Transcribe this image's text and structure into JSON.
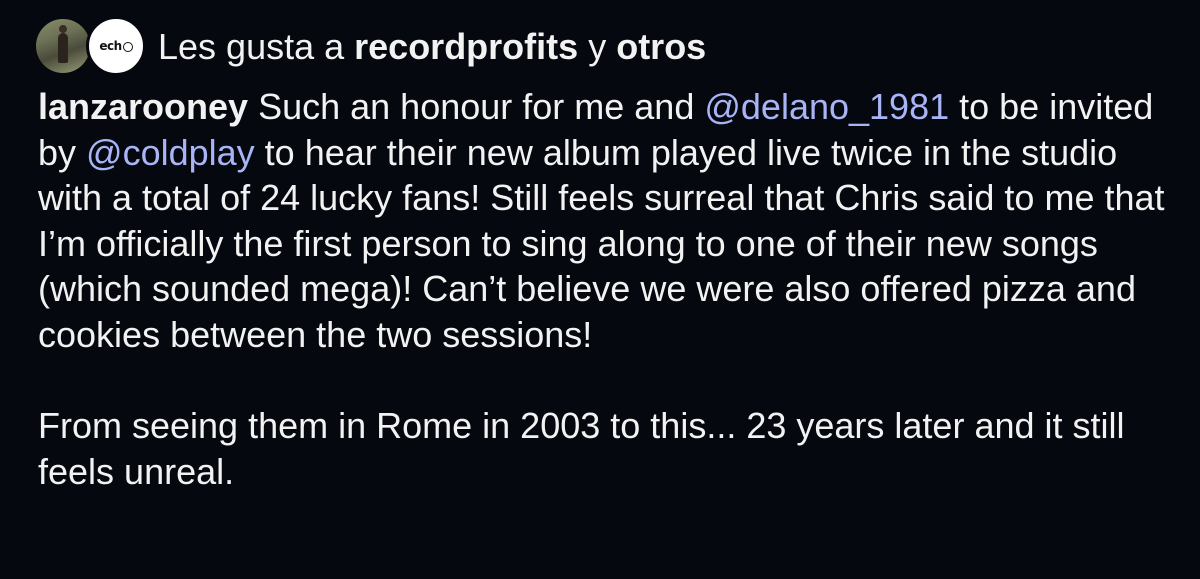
{
  "likes": {
    "prefix": "Les gusta a ",
    "user": "recordprofits",
    "connector": " y ",
    "others": "otros"
  },
  "avatars": [
    {
      "name": "liker-avatar-photo"
    },
    {
      "name": "echo-avatar",
      "text": "ech"
    }
  ],
  "caption": {
    "username": "lanzarooney",
    "text_1": " Such an honour for me and ",
    "mention_1": "@delano_1981",
    "text_2": " to be invited by ",
    "mention_2": "@coldplay",
    "text_3": " to hear their new album played live twice in the studio with a total of 24 lucky fans! Still feels surreal that Chris said to me that I’m officially the first person to sing along to one of their new songs (which sounded mega)! Can’t believe we were also offered pizza and cookies between the two sessions!",
    "paragraph_2": "From seeing them in Rome in 2003 to this... 23 years later and it still feels unreal."
  },
  "colors": {
    "background": "#05080f",
    "text": "#f2f2f2",
    "mention": "#a9b4f6"
  }
}
